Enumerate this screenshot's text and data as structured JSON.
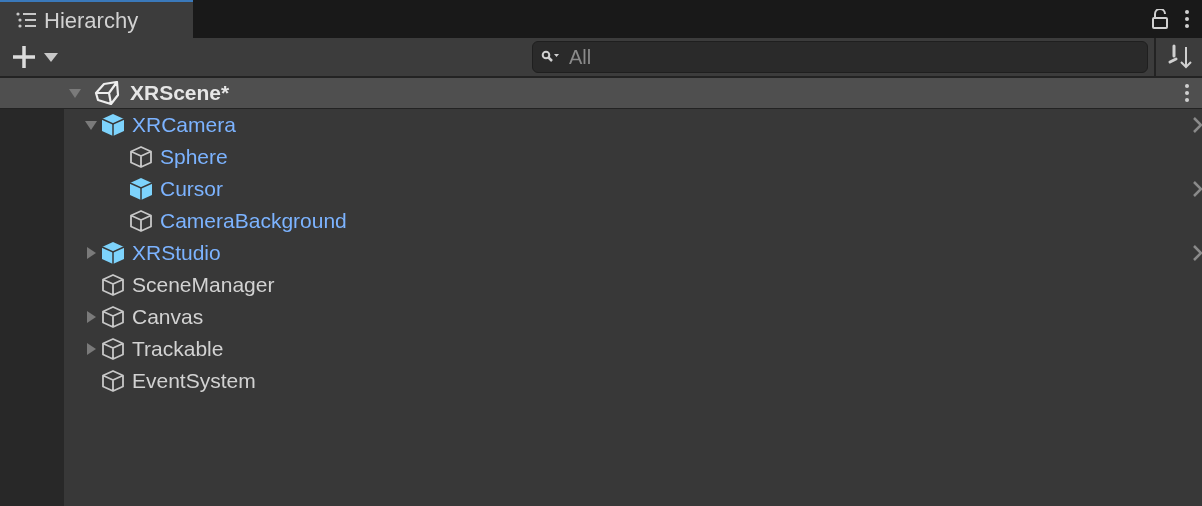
{
  "tab": {
    "title": "Hierarchy",
    "selected": true
  },
  "search": {
    "placeholder": "All"
  },
  "scene": {
    "name": "XRScene*",
    "expanded": true,
    "children": [
      {
        "name": "XRCamera",
        "kind": "prefab",
        "expanded": true,
        "children": [
          {
            "name": "Sphere",
            "kind": "prefab-part"
          },
          {
            "name": "Cursor",
            "kind": "prefab"
          },
          {
            "name": "CameraBackground",
            "kind": "prefab-part"
          }
        ]
      },
      {
        "name": "XRStudio",
        "kind": "prefab",
        "expanded": false
      },
      {
        "name": "SceneManager",
        "kind": "plain"
      },
      {
        "name": "Canvas",
        "kind": "plain",
        "expanded": false
      },
      {
        "name": "Trackable",
        "kind": "plain",
        "expanded": false
      },
      {
        "name": "EventSystem",
        "kind": "plain"
      }
    ]
  }
}
